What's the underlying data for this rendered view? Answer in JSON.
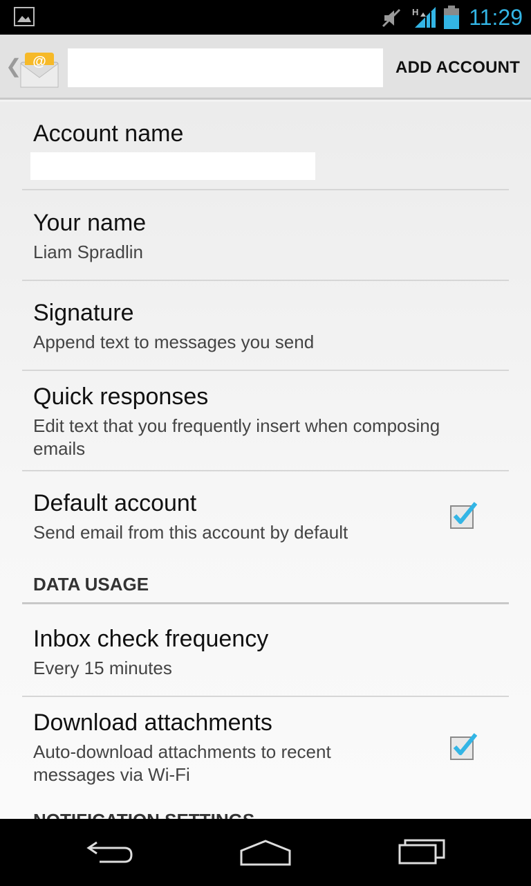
{
  "status_bar": {
    "time": "11:29",
    "network_type": "H",
    "icons": [
      "image-notification-icon",
      "mute-icon",
      "signal-icon",
      "battery-icon"
    ],
    "accent_color": "#33b5e5"
  },
  "action_bar": {
    "title": "",
    "add_account_label": "ADD ACCOUNT",
    "app_icon": "email-icon",
    "app_icon_glyph": "@"
  },
  "settings": {
    "account_name": {
      "title": "Account name",
      "value": ""
    },
    "your_name": {
      "title": "Your name",
      "summary": "Liam Spradlin"
    },
    "signature": {
      "title": "Signature",
      "summary": "Append text to messages you send"
    },
    "quick_responses": {
      "title": "Quick responses",
      "summary": "Edit text that you frequently insert when composing emails"
    },
    "default_account": {
      "title": "Default account",
      "summary": "Send email from this account by default",
      "checked": true
    },
    "data_usage_header": "DATA USAGE",
    "inbox_check_frequency": {
      "title": "Inbox check frequency",
      "summary": "Every 15 minutes"
    },
    "download_attachments": {
      "title": "Download attachments",
      "summary": "Auto-download attachments to recent messages via Wi-Fi",
      "checked": true
    },
    "notification_settings_header": "NOTIFICATION SETTINGS"
  },
  "nav_bar": {
    "buttons": [
      "back-icon",
      "home-icon",
      "recents-icon"
    ]
  }
}
